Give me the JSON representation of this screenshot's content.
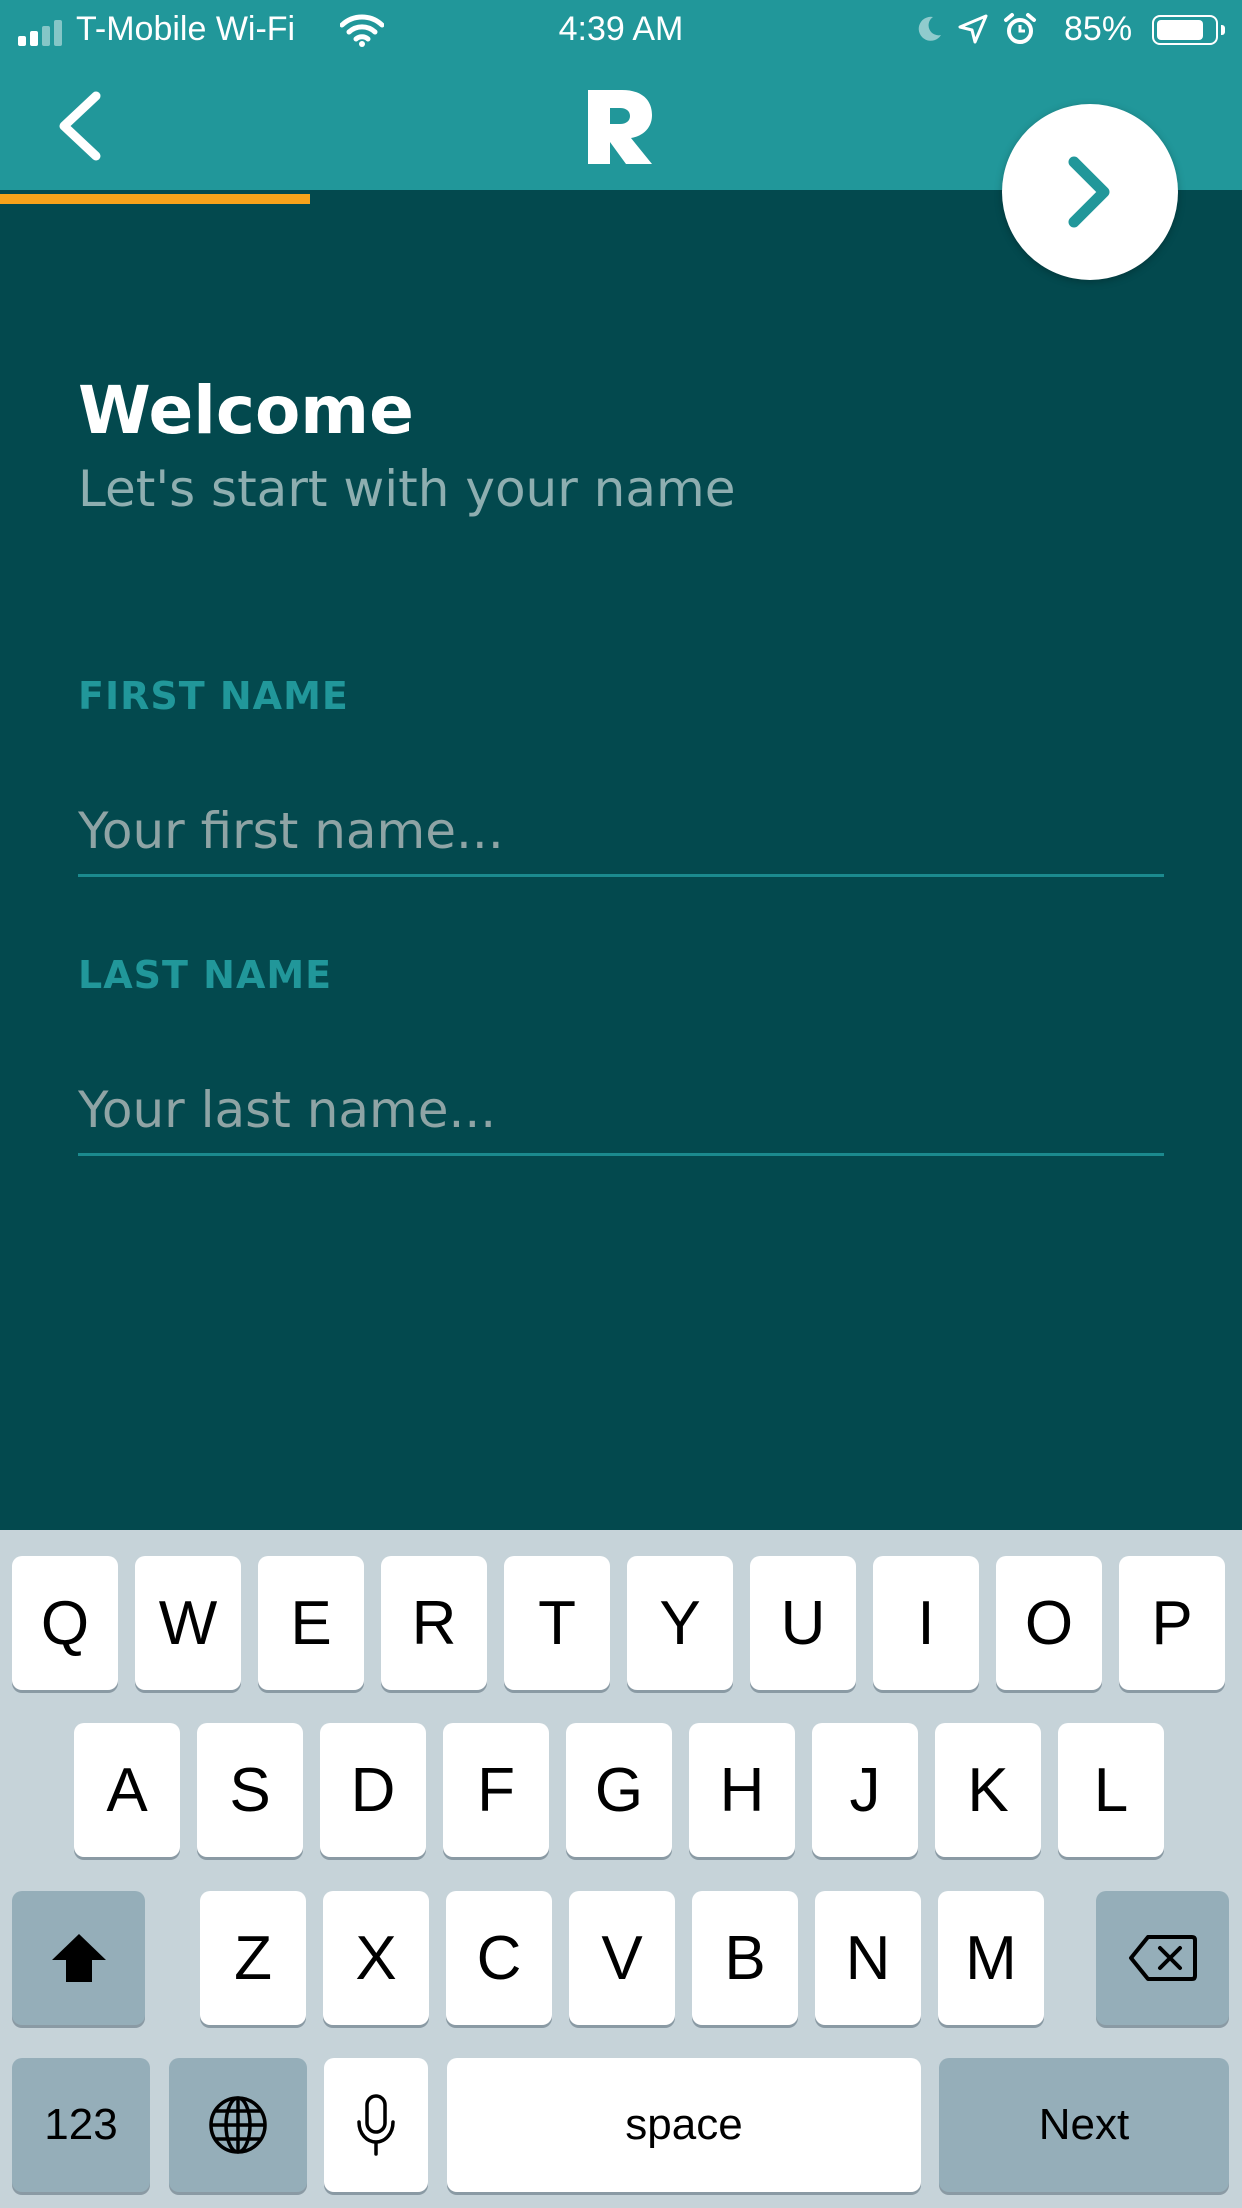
{
  "status_bar": {
    "carrier": "T-Mobile Wi-Fi",
    "time": "4:39 AM",
    "battery": "85%",
    "battery_level": 0.85
  },
  "header": {
    "back_icon": "chevron-left-icon",
    "logo_icon": "r-logo-icon",
    "next_icon": "chevron-right-icon",
    "progress_fraction": 0.25,
    "colors": {
      "header": "#21979a",
      "background": "#03494e",
      "progress": "#f7a21b"
    }
  },
  "form": {
    "title": "Welcome",
    "subtitle": "Let's start with your name",
    "first_name": {
      "label": "FIRST NAME",
      "placeholder": "Your first name...",
      "value": ""
    },
    "last_name": {
      "label": "LAST NAME",
      "placeholder": "Your last name...",
      "value": ""
    }
  },
  "keyboard": {
    "row1": [
      "Q",
      "W",
      "E",
      "R",
      "T",
      "Y",
      "U",
      "I",
      "O",
      "P"
    ],
    "row2": [
      "A",
      "S",
      "D",
      "F",
      "G",
      "H",
      "J",
      "K",
      "L"
    ],
    "row3": [
      "Z",
      "X",
      "C",
      "V",
      "B",
      "N",
      "M"
    ],
    "numbers_key": "123",
    "space_key": "space",
    "return_key": "Next",
    "shift_icon": "shift-icon",
    "delete_icon": "backspace-icon",
    "globe_icon": "globe-icon",
    "mic_icon": "microphone-icon"
  }
}
